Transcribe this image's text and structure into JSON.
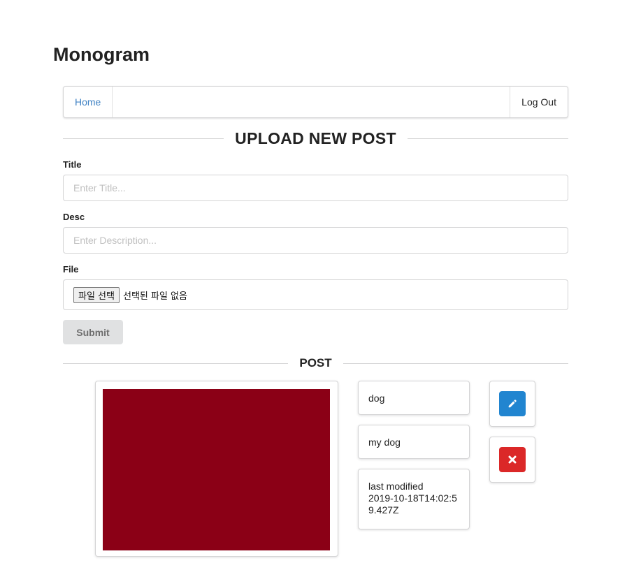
{
  "app": {
    "title": "Monogram"
  },
  "nav": {
    "home_label": "Home",
    "logout_label": "Log Out"
  },
  "upload": {
    "heading": "UPLOAD NEW POST",
    "title_label": "Title",
    "title_placeholder": "Enter Title...",
    "title_value": "",
    "desc_label": "Desc",
    "desc_placeholder": "Enter Description...",
    "desc_value": "",
    "file_label": "File",
    "file_button_label": "파일 선택",
    "file_status": "선택된 파일 없음",
    "submit_label": "Submit"
  },
  "post": {
    "heading": "POST",
    "title": "dog",
    "description": "my dog",
    "modified_label": "last modified",
    "modified_value": "2019-10-18T14:02:59.427Z",
    "image_color": "#8b0016",
    "edit_icon": "pencil-icon",
    "delete_icon": "close-icon"
  },
  "colors": {
    "link": "#4183c4",
    "edit_button": "#2185d0",
    "delete_button": "#db2828",
    "submit_button": "#e0e1e2"
  }
}
